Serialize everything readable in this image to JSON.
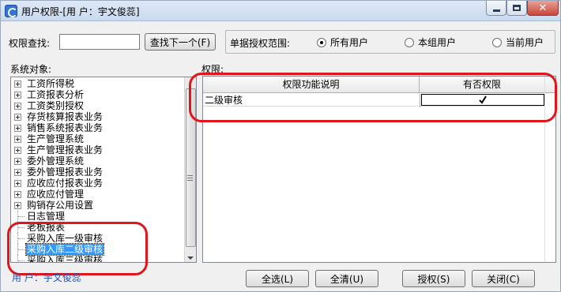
{
  "window": {
    "title": "用户权限-[用 户：宇文俊蕊]"
  },
  "search": {
    "label": "权限查找:",
    "value": "",
    "find_next_label": "查找下一个(F)"
  },
  "scope": {
    "label": "单据授权范围:",
    "options": [
      {
        "label": "所有用户",
        "selected": true
      },
      {
        "label": "本组用户",
        "selected": false
      },
      {
        "label": "当前用户",
        "selected": false
      }
    ]
  },
  "tree": {
    "label": "系统对象:",
    "items": [
      {
        "label": "工资所得税",
        "expandable": true,
        "selected": false
      },
      {
        "label": "工资报表分析",
        "expandable": true,
        "selected": false
      },
      {
        "label": "工资类别授权",
        "expandable": true,
        "selected": false
      },
      {
        "label": "存货核算报表业务",
        "expandable": true,
        "selected": false
      },
      {
        "label": "销售系统报表业务",
        "expandable": true,
        "selected": false
      },
      {
        "label": "生产管理系统",
        "expandable": true,
        "selected": false
      },
      {
        "label": "生产管理报表业务",
        "expandable": true,
        "selected": false
      },
      {
        "label": "委外管理系统",
        "expandable": true,
        "selected": false
      },
      {
        "label": "委外管理报表业务",
        "expandable": true,
        "selected": false
      },
      {
        "label": "应收应付报表业务",
        "expandable": true,
        "selected": false
      },
      {
        "label": "应收应付管理",
        "expandable": true,
        "selected": false
      },
      {
        "label": "购销存公用设置",
        "expandable": true,
        "selected": false
      },
      {
        "label": "日志管理",
        "expandable": false,
        "selected": false
      },
      {
        "label": "老板报表",
        "expandable": false,
        "selected": false
      },
      {
        "label": "采购入库一级审核",
        "expandable": false,
        "selected": false
      },
      {
        "label": "采购入库二级审核",
        "expandable": false,
        "selected": true
      },
      {
        "label": "采购入库三级审核",
        "expandable": false,
        "selected": false
      }
    ]
  },
  "permissions": {
    "label": "权限:",
    "columns": [
      "权限功能说明",
      "有否权限"
    ],
    "rows": [
      {
        "description": "二级审核",
        "granted": true
      }
    ]
  },
  "status": {
    "user_text": "用 户：宇文俊蕊"
  },
  "buttons": {
    "select_all": "全选(L)",
    "clear_all": "全清(U)",
    "grant": "授权(S)",
    "close": "关闭(C)"
  },
  "colors": {
    "selection": "#3399ff",
    "annotation": "#e0161c",
    "status_text": "#1b54c4"
  },
  "icons": {
    "app": "app-icon",
    "minimize": "minimize-icon",
    "maximize": "maximize-icon",
    "close": "close-icon",
    "check": "checkmark-icon"
  }
}
